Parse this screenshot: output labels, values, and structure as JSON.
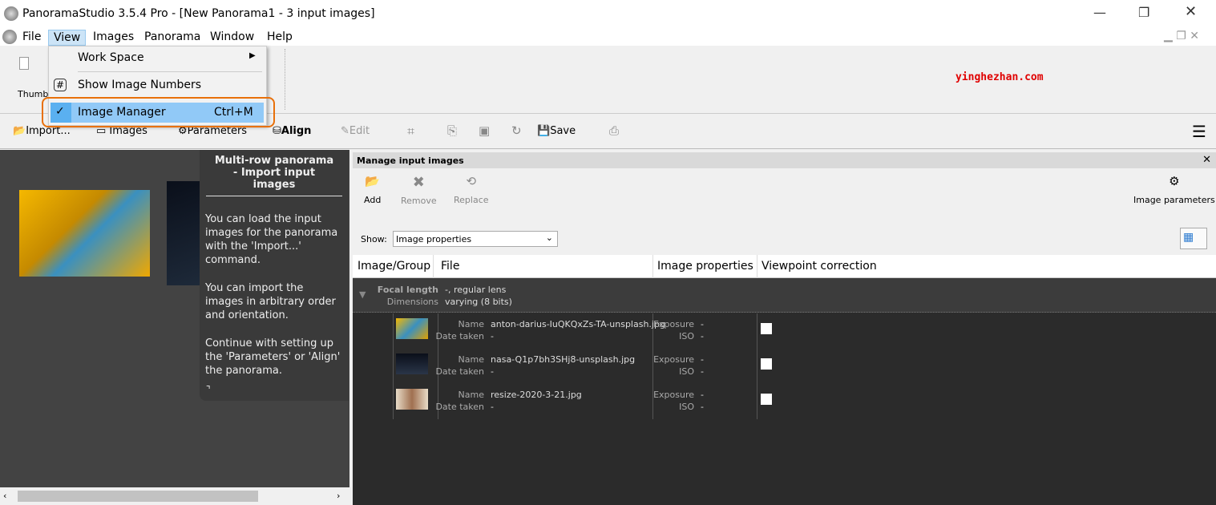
{
  "window": {
    "title": "PanoramaStudio 3.5.4 Pro - [New Panorama1 - 3 input images]"
  },
  "menubar": {
    "items": [
      "File",
      "View",
      "Images",
      "Panorama",
      "Window",
      "Help"
    ]
  },
  "view_menu": {
    "work_space": "Work Space",
    "show_numbers": "Show Image Numbers",
    "image_manager": "Image Manager",
    "image_manager_shortcut": "Ctrl+M",
    "image_manager_checked": true
  },
  "toolbar1": {
    "thumbnails_label": "Thumbn"
  },
  "watermark": "yinghezhan.com",
  "toolbar2": {
    "import": "Import...",
    "images": "Images",
    "parameters": "Parameters",
    "align": "Align",
    "edit": "Edit",
    "save": "Save"
  },
  "help": {
    "title": "Multi-row panorama - Import input images",
    "p1": "You can load the input images for the panorama with the 'Import...' command.",
    "p2": "You can import the images in arbitrary order and orientation.",
    "p3": "Continue with setting up the 'Parameters' or 'Align' the panorama."
  },
  "manager": {
    "title": "Manage input images",
    "add": "Add",
    "remove": "Remove",
    "replace": "Replace",
    "image_parameters": "Image parameters",
    "show_label": "Show:",
    "show_value": "Image properties",
    "columns": [
      "Image/Group",
      "File",
      "Image properties",
      "Viewpoint correction"
    ],
    "group": {
      "focal_label": "Focal length",
      "focal_value": "-, regular lens",
      "dim_label": "Dimensions",
      "dim_value": "varying (8 bits)"
    },
    "labels": {
      "name": "Name",
      "date": "Date taken",
      "exposure": "Exposure",
      "iso": "ISO"
    },
    "rows": [
      {
        "name": "anton-darius-IuQKQxZs-TA-unsplash.jpg",
        "date": "-",
        "exposure": "-",
        "iso": "-"
      },
      {
        "name": "nasa-Q1p7bh3SHj8-unsplash.jpg",
        "date": "-",
        "exposure": "-",
        "iso": "-"
      },
      {
        "name": "resize-2020-3-21.jpg",
        "date": "-",
        "exposure": "-",
        "iso": "-"
      }
    ]
  },
  "colors": {
    "highlight": "#e8700a",
    "menu_selected": "#91c9f7",
    "watermark": "#e00000"
  }
}
